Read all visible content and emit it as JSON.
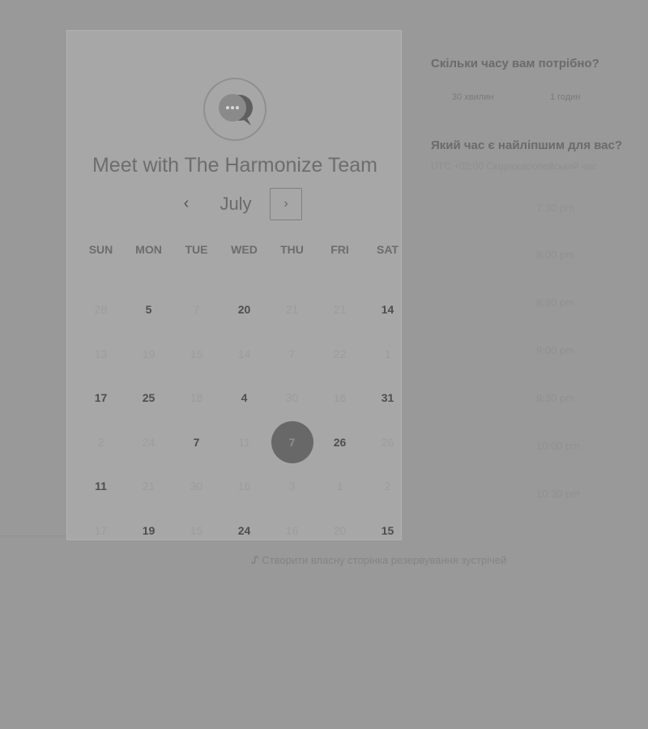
{
  "meeting": {
    "title": "Meet with The Harmonize Team"
  },
  "calendar": {
    "month": "July",
    "prev_icon": "‹",
    "next_icon": "›",
    "weekdays": [
      "SUN",
      "MON",
      "TUE",
      "WED",
      "THU",
      "FRI",
      "SAT"
    ],
    "weeks": [
      [
        {
          "d": "28",
          "a": false
        },
        {
          "d": "5",
          "a": true
        },
        {
          "d": "7",
          "a": false
        },
        {
          "d": "20",
          "a": true
        },
        {
          "d": "21",
          "a": false
        },
        {
          "d": "21",
          "a": false
        },
        {
          "d": "14",
          "a": true
        }
      ],
      [
        {
          "d": "13",
          "a": false
        },
        {
          "d": "19",
          "a": false
        },
        {
          "d": "15",
          "a": false
        },
        {
          "d": "14",
          "a": false
        },
        {
          "d": "7",
          "a": false
        },
        {
          "d": "22",
          "a": false
        },
        {
          "d": "1",
          "a": false
        }
      ],
      [
        {
          "d": "17",
          "a": true
        },
        {
          "d": "25",
          "a": true
        },
        {
          "d": "18",
          "a": false
        },
        {
          "d": "4",
          "a": true
        },
        {
          "d": "30",
          "a": false
        },
        {
          "d": "16",
          "a": false
        },
        {
          "d": "31",
          "a": true
        }
      ],
      [
        {
          "d": "2",
          "a": false
        },
        {
          "d": "24",
          "a": false
        },
        {
          "d": "7",
          "a": true
        },
        {
          "d": "11",
          "a": false
        },
        {
          "d": "7",
          "a": true,
          "selected": true
        },
        {
          "d": "26",
          "a": true
        },
        {
          "d": "26",
          "a": false
        }
      ],
      [
        {
          "d": "11",
          "a": true
        },
        {
          "d": "21",
          "a": false
        },
        {
          "d": "30",
          "a": false
        },
        {
          "d": "16",
          "a": false
        },
        {
          "d": "3",
          "a": false
        },
        {
          "d": "1",
          "a": false
        },
        {
          "d": "2",
          "a": false
        }
      ],
      [
        {
          "d": "17",
          "a": false
        },
        {
          "d": "19",
          "a": true
        },
        {
          "d": "15",
          "a": false
        },
        {
          "d": "24",
          "a": true
        },
        {
          "d": "16",
          "a": false
        },
        {
          "d": "20",
          "a": false
        },
        {
          "d": "15",
          "a": true
        }
      ]
    ]
  },
  "duration": {
    "question": "Скільки часу вам потрібно?",
    "options": [
      "30 хвилин",
      "1 годин"
    ]
  },
  "time": {
    "question": "Який час є найліпшим для вас?",
    "timezone": "UTC +02:00 Східноєвропейський час",
    "slots": [
      "7:30 pm",
      "8:00 pm",
      "8:30 pm",
      "9:00 pm",
      "9:30 pm",
      "10:00 pm",
      "10:30 pm"
    ]
  },
  "footer": {
    "icon": "hubspot-sprocket-icon",
    "link": "Створити власну сторінка резервування зустрічей"
  }
}
